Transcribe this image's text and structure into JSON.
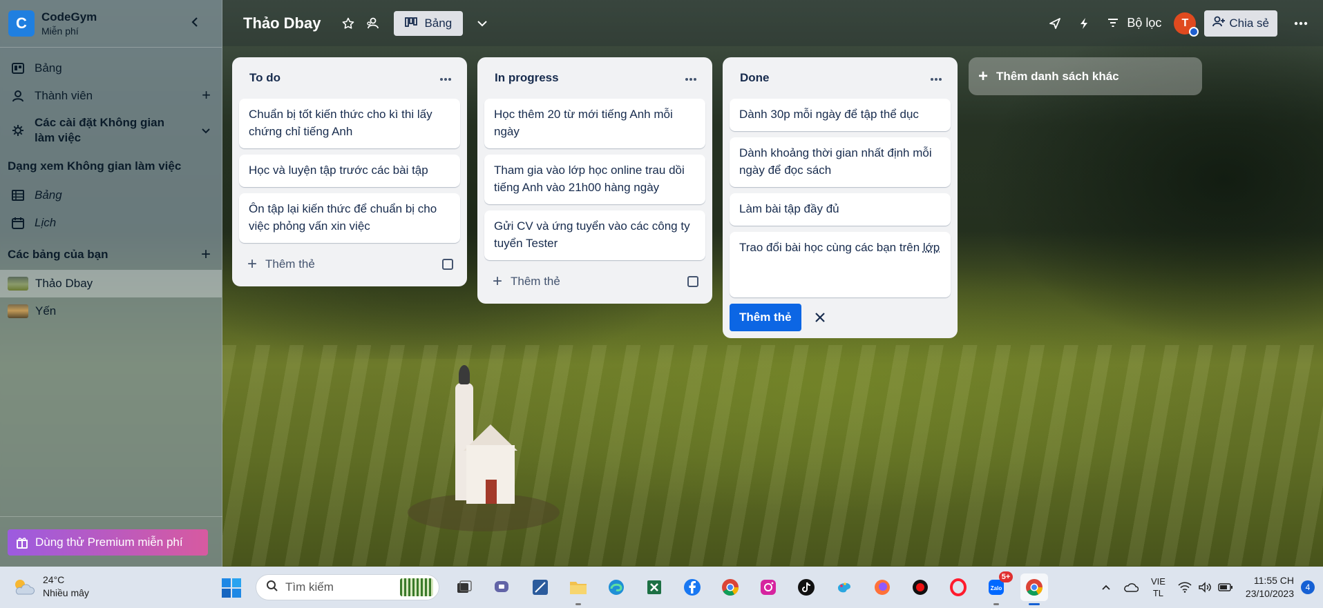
{
  "workspace": {
    "logo_letter": "C",
    "name": "CodeGym",
    "plan": "Miễn phí"
  },
  "sidebar": {
    "nav": [
      {
        "label": "Bảng",
        "icon": "board-icon"
      },
      {
        "label": "Thành viên",
        "icon": "person-icon"
      },
      {
        "label": "Các cài đặt Không gian làm việc",
        "icon": "gear-icon"
      }
    ],
    "views_title": "Dạng xem Không gian làm việc",
    "views": [
      {
        "label": "Bảng",
        "icon": "table-icon"
      },
      {
        "label": "Lịch",
        "icon": "calendar-icon"
      }
    ],
    "boards_title": "Các bảng của bạn",
    "boards": [
      {
        "label": "Thảo Dbay",
        "active": true
      },
      {
        "label": "Yến",
        "active": false
      }
    ],
    "premium_label": "Dùng thử Premium miễn phí"
  },
  "boardbar": {
    "title": "Thảo Dbay",
    "view_label": "Bảng",
    "filter_label": "Bộ lọc",
    "avatar_letter": "T",
    "share_label": "Chia sẻ"
  },
  "lists": [
    {
      "title": "To do",
      "cards": [
        "Chuẩn bị tốt kiến thức cho kì thi lấy chứng chỉ tiếng Anh",
        "Học và luyện tập trước các bài tập",
        "Ôn tập lại kiến thức để chuẩn bị cho việc phỏng vấn xin việc"
      ],
      "add_label": "Thêm thẻ"
    },
    {
      "title": "In progress",
      "cards": [
        "Học thêm 20 từ mới tiếng Anh mỗi ngày",
        "Tham gia vào lớp học online trau dồi tiếng Anh vào 21h00 hàng ngày",
        "Gửi CV và ứng tuyển vào các công ty tuyển Tester"
      ],
      "add_label": "Thêm thẻ"
    },
    {
      "title": "Done",
      "cards": [
        "Dành 30p mỗi ngày để tập thể dục",
        "Dành khoảng thời gian nhất định mỗi ngày để đọc sách",
        "Làm bài tập đầy đủ"
      ],
      "editing_card_text": "Trao đổi bài học cùng các bạn trên ",
      "editing_card_underlined": "lớp",
      "submit_label": "Thêm thẻ"
    }
  ],
  "add_list_label": "Thêm danh sách khác",
  "taskbar": {
    "temperature": "24°C",
    "weather_desc": "Nhiều mây",
    "search_placeholder": "Tìm kiếm",
    "zalo_badge": "5+",
    "lang_top": "VIE",
    "lang_bottom": "TL",
    "time": "11:55 CH",
    "date": "23/10/2023",
    "notification_count": "4"
  },
  "colors": {
    "primary_button": "#0c66e4",
    "premium_start": "#9c5be0",
    "premium_end": "#d75aa0",
    "logo": "#1f7fe0"
  }
}
